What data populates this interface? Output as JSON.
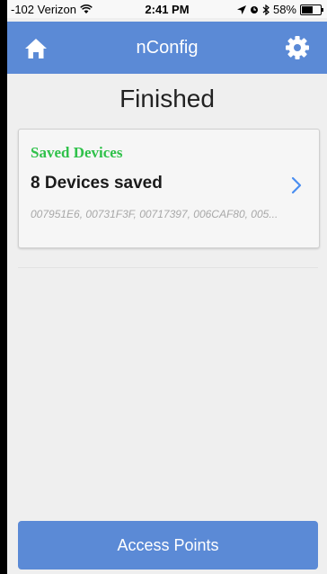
{
  "status_bar": {
    "carrier": "-102 Verizon",
    "time": "2:41 PM",
    "battery": "58%",
    "battery_level": 0.58,
    "icons": [
      "wifi-icon",
      "location-icon",
      "alarm-icon",
      "bluetooth-icon",
      "battery-icon"
    ]
  },
  "nav": {
    "title": "nConfig",
    "left_icon": "home-icon",
    "right_icon": "gear-icon",
    "color": "#5b8ad6"
  },
  "page": {
    "heading": "Finished"
  },
  "card": {
    "label": "Saved Devices",
    "label_color": "#2fc14a",
    "title": "8 Devices saved",
    "devices": "007951E6, 00731F3F, 00717397, 006CAF80, 005...",
    "chevron_icon": "chevron-right-icon"
  },
  "footer": {
    "button_label": "Access Points"
  }
}
